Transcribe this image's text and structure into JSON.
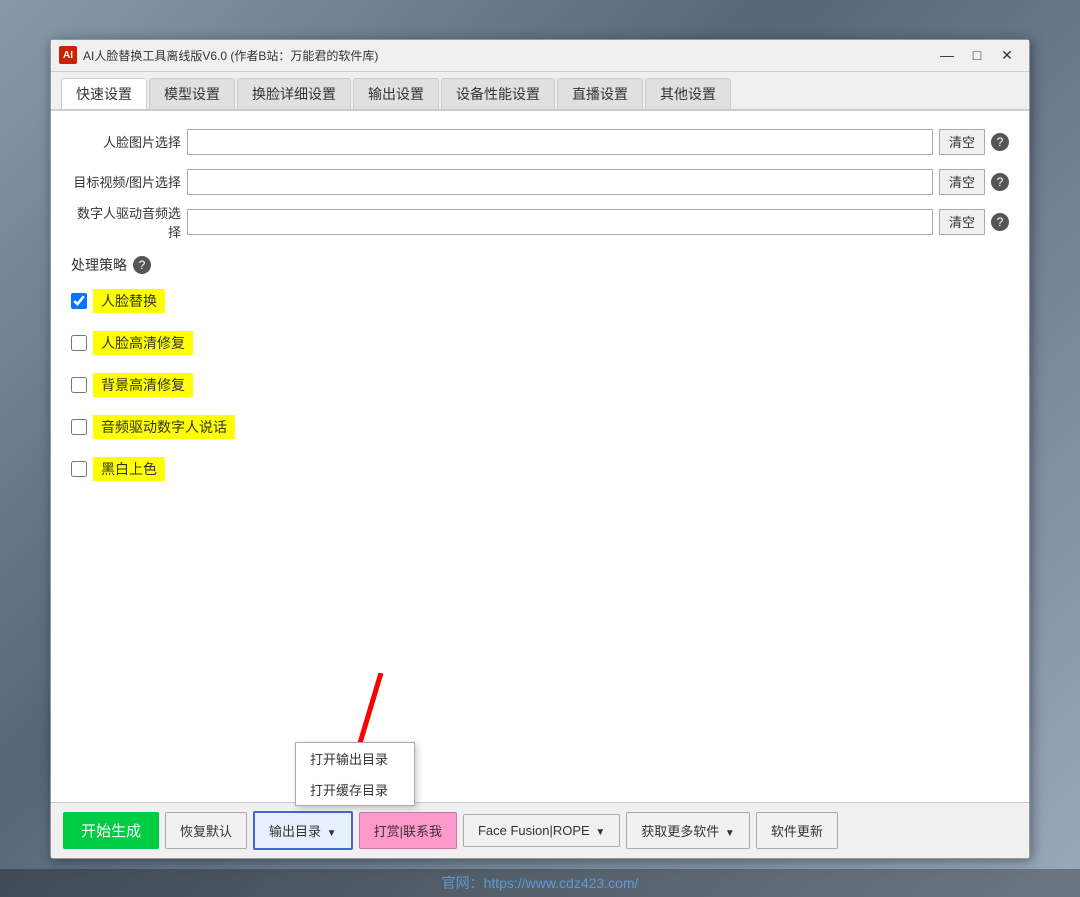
{
  "titlebar": {
    "icon_label": "AI",
    "title": "AI人脸替换工具离线版V6.0  (作者B站：万能君的软件库)",
    "minimize_label": "—",
    "maximize_label": "□",
    "close_label": "✕"
  },
  "tabs": [
    {
      "id": "quick",
      "label": "快速设置",
      "active": true
    },
    {
      "id": "model",
      "label": "模型设置",
      "active": false
    },
    {
      "id": "swap",
      "label": "换脸详细设置",
      "active": false
    },
    {
      "id": "output",
      "label": "输出设置",
      "active": false
    },
    {
      "id": "device",
      "label": "设备性能设置",
      "active": false
    },
    {
      "id": "live",
      "label": "直播设置",
      "active": false
    },
    {
      "id": "other",
      "label": "其他设置",
      "active": false
    }
  ],
  "inputs": [
    {
      "label": "人脸图片选择",
      "placeholder": "",
      "value": ""
    },
    {
      "label": "目标视频/图片选择",
      "placeholder": "",
      "value": ""
    },
    {
      "label": "数字人驱动音频选择",
      "placeholder": "",
      "value": ""
    }
  ],
  "clear_btn_label": "清空",
  "help_icon_symbol": "?",
  "processing": {
    "section_label": "处理策略",
    "help_icon_symbol": "?",
    "options": [
      {
        "id": "face_swap",
        "label": "人脸替换",
        "checked": true,
        "highlighted": true
      },
      {
        "id": "face_hd",
        "label": "人脸高清修复",
        "checked": false,
        "highlighted": true
      },
      {
        "id": "bg_hd",
        "label": "背景高清修复",
        "checked": false,
        "highlighted": true
      },
      {
        "id": "audio_drive",
        "label": "音频驱动数字人说话",
        "checked": false,
        "highlighted": true
      },
      {
        "id": "bw_color",
        "label": "黑白上色",
        "checked": false,
        "highlighted": true
      }
    ]
  },
  "bottombar": {
    "start_btn": "开始生成",
    "default_btn": "恢复默认",
    "output_btn": "输出目录",
    "donate_btn": "打赏|联系我",
    "facefusion_btn": "Face Fusion|ROPE",
    "more_btn": "获取更多软件",
    "update_btn": "软件更新"
  },
  "dropdown": {
    "items": [
      {
        "label": "打开输出目录"
      },
      {
        "label": "打开缓存目录"
      }
    ]
  },
  "watermark": {
    "text": "官网：https://www.cdz423.com/"
  }
}
